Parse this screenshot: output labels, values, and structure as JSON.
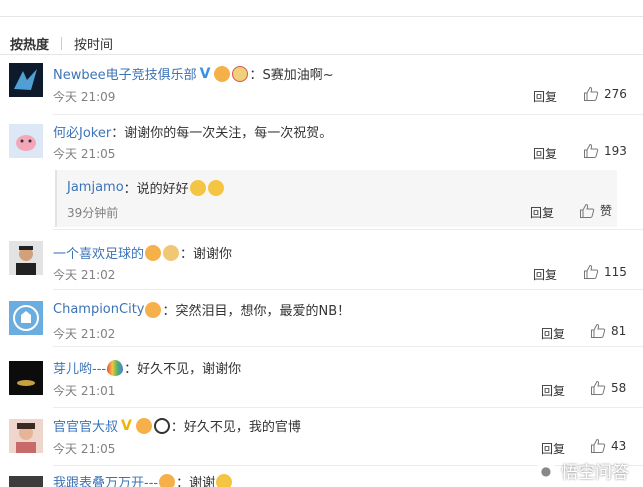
{
  "sort_bar": {
    "hot_label": "按热度",
    "time_label": "按时间"
  },
  "comments": [
    {
      "user": "Newbee电子竞技俱乐部",
      "text": "：S赛加油啊~",
      "time": "今天 21:09",
      "reply": "回复",
      "likes": "276"
    },
    {
      "user": "何必Joker",
      "text": "：谢谢你的每一次关注，每一次祝贺。",
      "time": "今天 21:05",
      "reply": "回复",
      "likes": "193"
    },
    {
      "user": "一个喜欢足球的",
      "text": "：谢谢你",
      "time": "今天 21:02",
      "reply": "回复",
      "likes": "115"
    },
    {
      "user": "ChampionCity",
      "text": "：突然泪目，想你，最爱的NB！",
      "time": "今天 21:02",
      "reply": "回复",
      "likes": "81"
    },
    {
      "user": "芽儿哟---",
      "text": "：好久不见，谢谢你",
      "time": "今天 21:01",
      "reply": "回复",
      "likes": "58"
    },
    {
      "user": "官官官大叔",
      "text": "：好久不见，我的官博",
      "time": "今天 21:05",
      "reply": "回复",
      "likes": "43"
    },
    {
      "user": "我跟表叠万万开---",
      "text": "：谢谢"
    }
  ],
  "sub_reply": {
    "user": "Jamjamo",
    "text": "：说的好好",
    "time": "39分钟前",
    "reply": "回复",
    "like": "赞"
  },
  "watermark": {
    "text": "悟空问答"
  },
  "colors": {
    "username": "#3b73b8",
    "verified_blue": "#3b8fe6",
    "verified_gold": "#f0b400",
    "muted": "#808080"
  }
}
